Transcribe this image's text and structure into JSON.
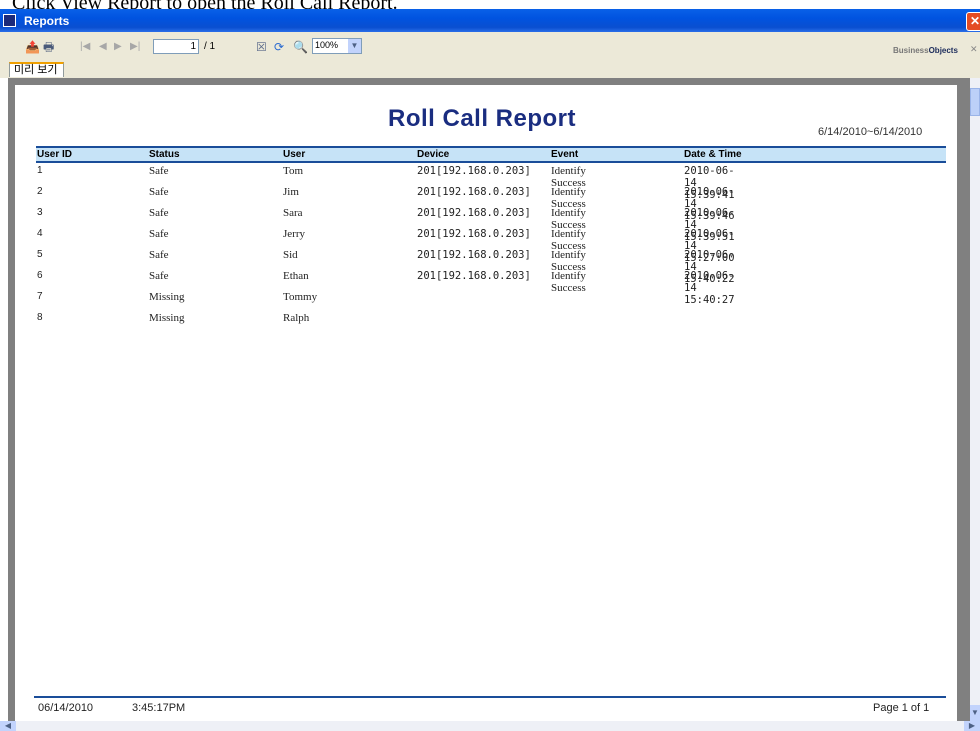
{
  "caption": {
    "text": "Click View Report to open the Roll Call Report."
  },
  "window": {
    "title": "Reports",
    "close": "✕"
  },
  "toolbar": {
    "page_value": "1",
    "page_total": "/ 1",
    "zoom": "100%",
    "logo_prefix": "Business",
    "logo_suffix": "Objects",
    "close": "✕"
  },
  "tabs": [
    {
      "label": "미리 보기"
    }
  ],
  "report": {
    "title": "Roll Call Report",
    "date_range": "6/14/2010~6/14/2010",
    "columns": [
      "User ID",
      "Status",
      "User",
      "Device",
      "Event",
      "Date & Time"
    ],
    "rows": [
      [
        "1",
        "Safe",
        "Tom",
        "201[192.168.0.203]",
        "Identify Success",
        "2010-06-14 15:39:41"
      ],
      [
        "2",
        "Safe",
        "Jim",
        "201[192.168.0.203]",
        "Identify Success",
        "2010-06-14 15:39:46"
      ],
      [
        "3",
        "Safe",
        "Sara",
        "201[192.168.0.203]",
        "Identify Success",
        "2010-06-14 15:39:51"
      ],
      [
        "4",
        "Safe",
        "Jerry",
        "201[192.168.0.203]",
        "Identify Success",
        "2010-06-14 15:27:00"
      ],
      [
        "5",
        "Safe",
        "Sid",
        "201[192.168.0.203]",
        "Identify Success",
        "2010-06-14 15:40:22"
      ],
      [
        "6",
        "Safe",
        "Ethan",
        "201[192.168.0.203]",
        "Identify Success",
        "2010-06-14 15:40:27"
      ],
      [
        "7",
        "Missing",
        "Tommy",
        "",
        "",
        ""
      ],
      [
        "8",
        "Missing",
        "Ralph",
        "",
        "",
        ""
      ]
    ],
    "footer": {
      "date": "06/14/2010",
      "time": "3:45:17PM",
      "page": "Page 1 of 1"
    }
  },
  "colors": {
    "title": "#1a2d80",
    "header_bg": "#c6e3f7",
    "rule": "#1a4d99"
  }
}
